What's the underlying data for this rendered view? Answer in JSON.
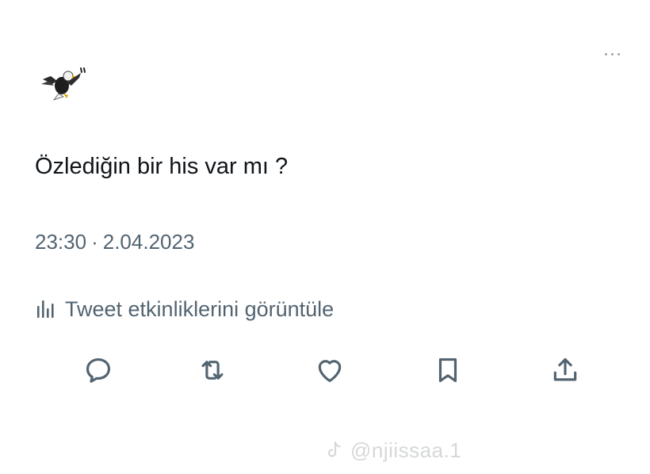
{
  "tweet": {
    "text": "Özlediğin bir his var mı ?",
    "time": "23:30",
    "separator": "·",
    "date": "2.04.2023"
  },
  "activity": {
    "label": "Tweet etkinliklerini görüntüle",
    "icon": "analytics-bars-icon"
  },
  "actions": [
    {
      "name": "reply",
      "icon": "reply-icon"
    },
    {
      "name": "retweet",
      "icon": "retweet-icon"
    },
    {
      "name": "like",
      "icon": "heart-icon"
    },
    {
      "name": "bookmark",
      "icon": "bookmark-icon"
    },
    {
      "name": "share",
      "icon": "share-icon"
    }
  ],
  "watermark": {
    "handle": "@njiissaa.1",
    "icon": "tiktok-icon"
  },
  "colors": {
    "text": "#0f1419",
    "secondary": "#536471",
    "background": "#ffffff"
  }
}
